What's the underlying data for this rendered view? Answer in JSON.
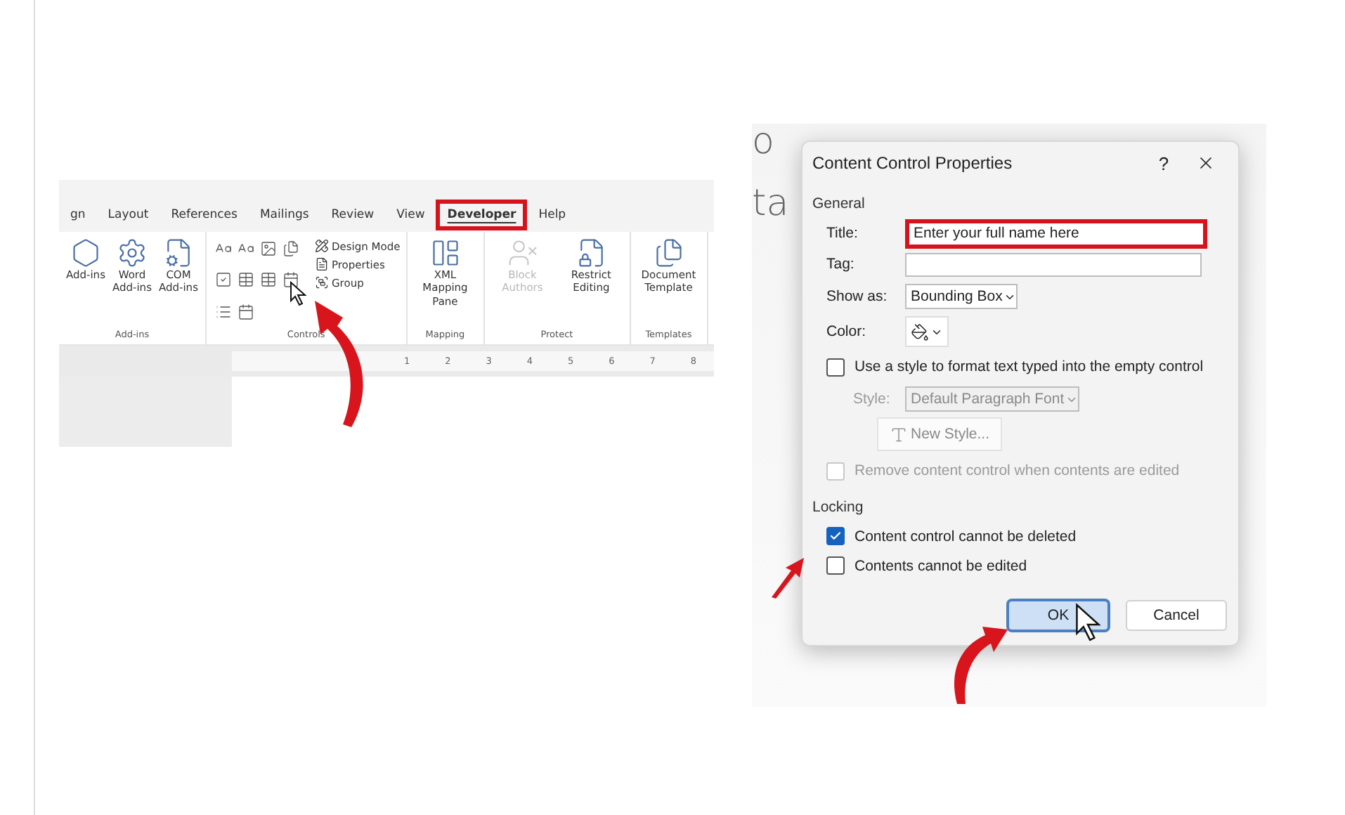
{
  "ribbon": {
    "tabs": [
      {
        "label": "gn",
        "selected": false,
        "highlighted": false
      },
      {
        "label": "Layout",
        "selected": false,
        "highlighted": false
      },
      {
        "label": "References",
        "selected": false,
        "highlighted": false
      },
      {
        "label": "Mailings",
        "selected": false,
        "highlighted": false
      },
      {
        "label": "Review",
        "selected": false,
        "highlighted": false
      },
      {
        "label": "View",
        "selected": false,
        "highlighted": false
      },
      {
        "label": "Developer",
        "selected": true,
        "highlighted": true
      },
      {
        "label": "Help",
        "selected": false,
        "highlighted": false
      }
    ],
    "groups": [
      {
        "label": "Add-ins",
        "items": [
          {
            "kind": "large",
            "label": "Add-ins",
            "disabled": false
          },
          {
            "kind": "large",
            "label": "Word Add-ins",
            "disabled": false
          },
          {
            "kind": "large",
            "label": "COM Add-ins",
            "disabled": false
          }
        ]
      },
      {
        "label": "Controls",
        "items": [
          {
            "kind": "grid"
          },
          {
            "kind": "small",
            "label": "Design Mode"
          },
          {
            "kind": "small",
            "label": "Properties"
          },
          {
            "kind": "small",
            "label": "Group"
          }
        ]
      },
      {
        "label": "Mapping",
        "items": [
          {
            "kind": "large",
            "label": "XML Mapping Pane",
            "disabled": false
          }
        ]
      },
      {
        "label": "Protect",
        "items": [
          {
            "kind": "large",
            "label": "Block Authors",
            "disabled": true
          },
          {
            "kind": "large",
            "label": "Restrict Editing",
            "disabled": false
          }
        ]
      },
      {
        "label": "Templates",
        "items": [
          {
            "kind": "large",
            "label": "Document Template",
            "disabled": false
          }
        ]
      }
    ],
    "ruler": [
      "1",
      "2",
      "3",
      "4",
      "5",
      "6",
      "7",
      "8"
    ]
  },
  "background_text": [
    "o",
    "ta"
  ],
  "dialog": {
    "title": "Content Control Properties",
    "help": "?",
    "general": {
      "heading": "General",
      "title_field": {
        "label": "Title:",
        "value": "Enter your full name here",
        "highlighted": true
      },
      "tag_field": {
        "label": "Tag:"
      },
      "show_as": {
        "label": "Show as:",
        "value": "Bounding Box"
      },
      "color": {
        "label": "Color:"
      },
      "use_style": {
        "label": "Use a style to format text typed into the empty control",
        "checked": false
      },
      "style": {
        "label": "Style:",
        "value": "Default Paragraph Font",
        "disabled": true
      },
      "new_style": {
        "label": "New Style...",
        "disabled": true
      },
      "remove": {
        "label": "Remove content control when contents are edited",
        "checked": false,
        "disabled": true
      }
    },
    "locking": {
      "heading": "Locking",
      "options": [
        {
          "label": "Content control cannot be deleted",
          "checked": true
        },
        {
          "label": "Contents cannot be edited",
          "checked": false
        }
      ]
    },
    "buttons": [
      {
        "label": "OK",
        "focused": true
      },
      {
        "label": "Cancel",
        "focused": false
      }
    ]
  }
}
